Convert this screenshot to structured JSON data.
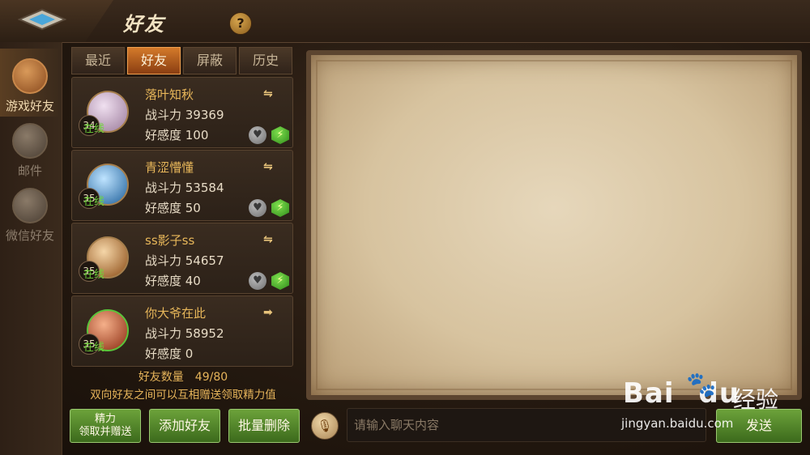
{
  "header": {
    "title": "好友",
    "help_icon": "?"
  },
  "sidebar": {
    "items": [
      {
        "label": "游戏好友",
        "icon": "handshake-icon",
        "active": true
      },
      {
        "label": "邮件",
        "icon": "mail-icon",
        "active": false
      },
      {
        "label": "微信好友",
        "icon": "wechat-handshake-icon",
        "active": false
      }
    ]
  },
  "tabs": [
    {
      "label": "最近",
      "active": false
    },
    {
      "label": "好友",
      "active": true
    },
    {
      "label": "屏蔽",
      "active": false
    },
    {
      "label": "历史",
      "active": false
    }
  ],
  "friends": [
    {
      "name": "落叶知秋",
      "power": "战斗力 39369",
      "affinity": "好感度 100",
      "level": "34",
      "status": "在线",
      "avatar_color": "#c9a6c9",
      "relation_icon": "two-way-arrow-icon"
    },
    {
      "name": "青涩懵懂",
      "power": "战斗力 53584",
      "affinity": "好感度 50",
      "level": "35",
      "status": "在线",
      "avatar_color": "#3d8ec9",
      "relation_icon": "two-way-arrow-icon"
    },
    {
      "name": "ss影子ss",
      "power": "战斗力 54657",
      "affinity": "好感度 40",
      "level": "35",
      "status": "在线",
      "avatar_color": "#b36a2a",
      "relation_icon": "two-way-arrow-icon"
    },
    {
      "name": "你大爷在此",
      "power": "战斗力 58952",
      "affinity": "好感度 0",
      "level": "35",
      "status": "在线",
      "avatar_color": "#c94a2a",
      "relation_icon": "one-way-arrow-icon"
    }
  ],
  "summary": {
    "count": "好友数量　49/80",
    "tip": "双向好友之间可以互相赠送领取精力值"
  },
  "bottom": {
    "gift_line1": "精力",
    "gift_line2": "领取并赠送",
    "add_label": "添加好友",
    "delete_label": "批量删除",
    "input_placeholder": "请输入聊天内容",
    "send_label": "发送"
  },
  "watermark": {
    "logo": "Bai",
    "logo2": "du",
    "cn": "经验",
    "url": "jingyan.baidu.com"
  }
}
